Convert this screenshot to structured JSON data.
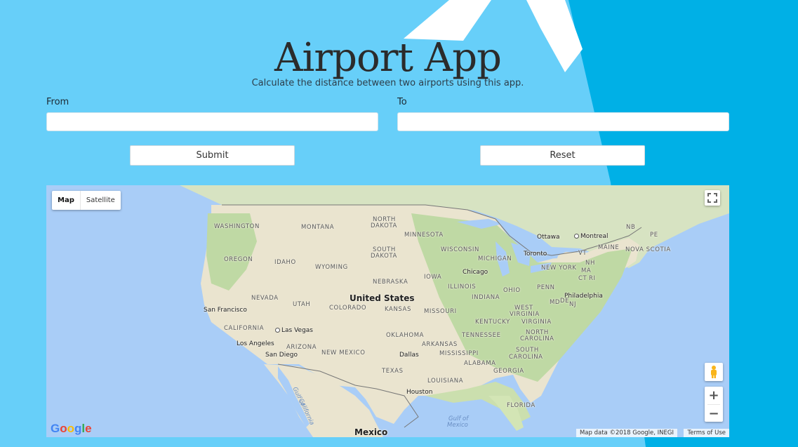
{
  "header": {
    "title": "Airport App",
    "subtitle": "Calculate the distance between two airports using this app."
  },
  "form": {
    "from_label": "From",
    "to_label": "To",
    "from_value": "",
    "to_value": "",
    "submit_label": "Submit",
    "reset_label": "Reset"
  },
  "map": {
    "map_type_options": [
      "Map",
      "Satellite"
    ],
    "selected_map_type": "Map",
    "zoom_in": "+",
    "zoom_out": "−",
    "logo": "Google",
    "attribution": "Map data ©2018 Google, INEGI",
    "terms": "Terms of Use",
    "labels": {
      "washington": "WASHINGTON",
      "montana": "MONTANA",
      "north_dakota_1": "NORTH",
      "north_dakota_2": "DAKOTA",
      "minnesota": "MINNESOTA",
      "south_dakota_1": "SOUTH",
      "south_dakota_2": "DAKOTA",
      "wisconsin": "WISCONSIN",
      "ottawa": "Ottawa",
      "montreal": "Montreal",
      "nb": "NB",
      "pe": "PE",
      "maine": "MAINE",
      "nova_scotia": "NOVA SCOTIA",
      "vt": "VT",
      "nh": "NH",
      "ma": "MA",
      "ct": "CT",
      "ri": "RI",
      "oregon": "OREGON",
      "idaho": "IDAHO",
      "wyoming": "WYOMING",
      "michigan": "MICHIGAN",
      "toronto": "Toronto",
      "new_york": "NEW YORK",
      "chicago": "Chicago",
      "iowa": "IOWA",
      "nebraska": "NEBRASKA",
      "illinois": "ILLINOIS",
      "ohio": "OHIO",
      "penn": "PENN",
      "nevada": "NEVADA",
      "utah": "UTAH",
      "united_states": "United States",
      "colorado": "COLORADO",
      "kansas": "KANSAS",
      "indiana": "INDIANA",
      "md": "MD",
      "de": "DE",
      "nj": "NJ",
      "philadelphia": "Philadelphia",
      "san_francisco": "San Francisco",
      "missouri": "MISSOURI",
      "west_virginia_1": "WEST",
      "west_virginia_2": "VIRGINIA",
      "virginia": "VIRGINIA",
      "kentucky": "KENTUCKY",
      "california": "CALIFORNIA",
      "las_vegas": "Las Vegas",
      "oklahoma": "OKLAHOMA",
      "tennessee": "TENNESSEE",
      "north_carolina_1": "NORTH",
      "north_carolina_2": "CAROLINA",
      "los_angeles": "Los Angeles",
      "arizona": "ARIZONA",
      "arkansas": "ARKANSAS",
      "san_diego": "San Diego",
      "new_mexico": "NEW MEXICO",
      "dallas": "Dallas",
      "mississippi": "MISSISSIPPI",
      "south_carolina_1": "SOUTH",
      "south_carolina_2": "CAROLINA",
      "alabama": "ALABAMA",
      "georgia": "GEORGIA",
      "texas": "TEXAS",
      "louisiana": "LOUISIANA",
      "houston": "Houston",
      "florida": "FLORIDA",
      "gulf_of_california_1": "Gulf of",
      "gulf_of_california_2": "California",
      "gulf_of_mexico_1": "Gulf of",
      "gulf_of_mexico_2": "Mexico",
      "mexico": "Mexico"
    }
  },
  "colors": {
    "background": "#67cff9",
    "background_stripe": "#00b0e6",
    "plane": "#ffffff",
    "land": "#eae4cf",
    "forest": "#bfd9a4",
    "water": "#a9cdf7"
  }
}
